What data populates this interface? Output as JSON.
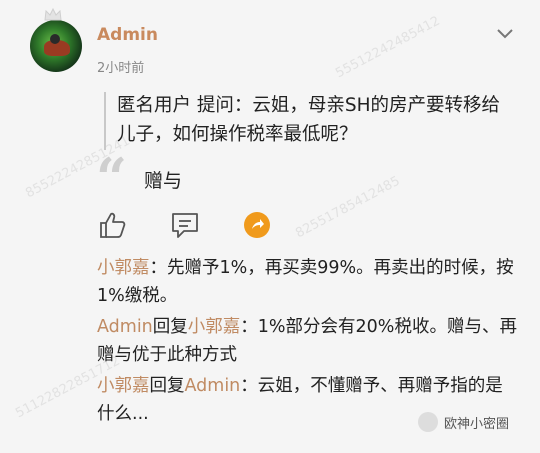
{
  "post": {
    "username": "Admin",
    "time": "2小时前",
    "quote": "匿名用户  提问：云姐，母亲SH的房产要转移给儿子，如何操作税率最低呢？",
    "answer": "赠与"
  },
  "comments": [
    {
      "author": "小郭嘉",
      "reply_word": "",
      "reply_to": "",
      "text": "：先赠予1%，再买卖99%。再卖出的时候，按1%缴税。"
    },
    {
      "author": "Admin",
      "reply_word": "回复",
      "reply_to": "小郭嘉",
      "text": "：1%部分会有20%税收。赠与、再赠与优于此种方式"
    },
    {
      "author": "小郭嘉",
      "reply_word": "回复",
      "reply_to": "Admin",
      "text": "：云姐，不懂赠予、再赠予指的是什么..."
    }
  ],
  "watermark": "欧神小密圈",
  "icons": {
    "menu": "chevron-down-icon",
    "like": "thumbs-up-icon",
    "reply": "comment-icon",
    "share": "share-icon",
    "crown": "crown-icon"
  },
  "colors": {
    "username": "#c98a5e",
    "share_bg": "#f09a1c"
  }
}
